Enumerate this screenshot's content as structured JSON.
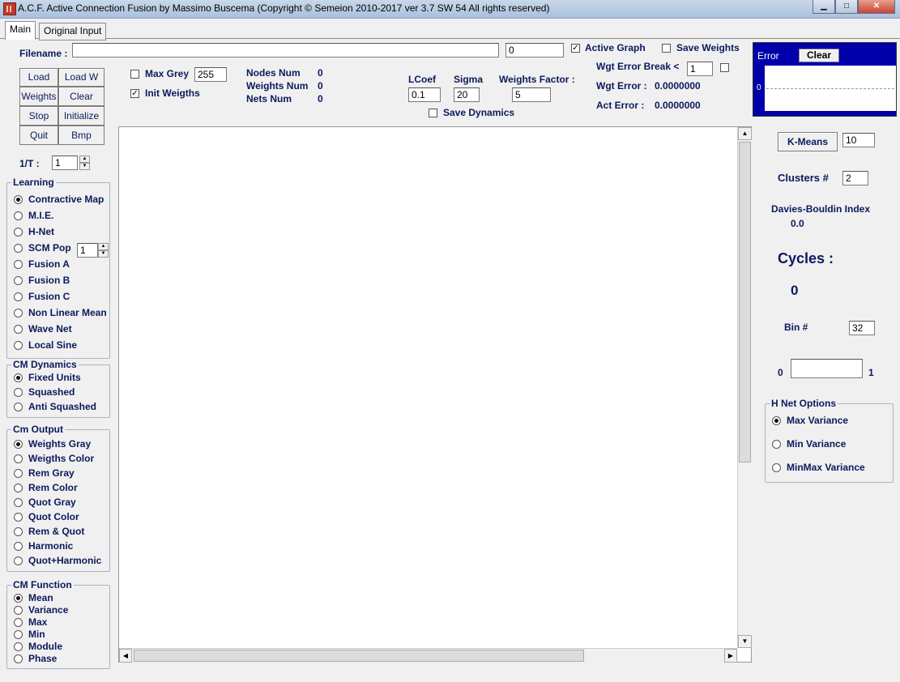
{
  "window": {
    "title": "A.C.F.  Active Connection Fusion  by Massimo Buscema (Copyright © Semeion 2010-2017 ver 3.7  SW 54 All rights reserved)"
  },
  "tabs": [
    "Main",
    "Original Input"
  ],
  "filename": {
    "label": "Filename :",
    "value": "",
    "count": "0"
  },
  "toggles": {
    "active_graph": "Active Graph",
    "save_weights": "Save Weights",
    "max_grey": "Max Grey",
    "init_weights": "Init Weigths",
    "save_dynamics": "Save Dynamics"
  },
  "max_grey_value": "255",
  "buttons": {
    "load": "Load",
    "load_w": "Load W",
    "weights": "Weights",
    "clear": "Clear",
    "stop": "Stop",
    "initialize": "Initialize",
    "quit": "Quit",
    "bmp": "Bmp"
  },
  "stats": {
    "nodes_label": "Nodes Num",
    "nodes": "0",
    "weights_label": "Weights Num",
    "weights": "0",
    "nets_label": "Nets Num",
    "nets": "0"
  },
  "params": {
    "lcoef_label": "LCoef",
    "lcoef": "0.1",
    "sigma_label": "Sigma",
    "sigma": "20",
    "wfactor_label": "Weights  Factor :",
    "wfactor": "5"
  },
  "errors": {
    "wgt_break_label": "Wgt Error Break  <",
    "wgt_break": "1",
    "wgt_error_label": "Wgt Error :",
    "wgt_error": "0.0000000",
    "act_error_label": "Act Error :",
    "act_error": "0.0000000"
  },
  "error_panel": {
    "label": "Error",
    "clear": "Clear",
    "zero": "0"
  },
  "inv_t": {
    "label": "1/T :",
    "value": "1"
  },
  "learning": {
    "title": "Learning",
    "options": [
      "Contractive Map",
      "M.I.E.",
      "H-Net",
      "SCM Pop",
      "Fusion A",
      "Fusion B",
      "Fusion C",
      "Non Linear Mean",
      "Wave Net",
      "Local Sine"
    ],
    "scm_pop_value": "1"
  },
  "cm_dynamics": {
    "title": "CM Dynamics",
    "options": [
      "Fixed Units",
      "Squashed",
      "Anti Squashed"
    ]
  },
  "cm_output": {
    "title": "Cm Output",
    "options": [
      "Weights Gray",
      "Weigths Color",
      "Rem Gray",
      "Rem Color",
      "Quot Gray",
      "Quot Color",
      "Rem & Quot",
      "Harmonic",
      "Quot+Harmonic"
    ]
  },
  "cm_function": {
    "title": "CM Function",
    "options": [
      "Mean",
      "Variance",
      "Max",
      "Min",
      "Module",
      "Phase"
    ]
  },
  "right": {
    "kmeans_label": "K-Means",
    "kmeans_value": "10",
    "clusters_label": "Clusters #",
    "clusters_value": "2",
    "db_label": "Davies-Bouldin Index",
    "db_value": "0.0",
    "cycles_label": "Cycles :",
    "cycles_value": "0",
    "bin_label": "Bin #",
    "bin_value": "32",
    "range_min": "0",
    "range_max": "1"
  },
  "hnet": {
    "title": "H Net Options",
    "options": [
      "Max Variance",
      "Min Variance",
      "MinMax Variance"
    ]
  }
}
